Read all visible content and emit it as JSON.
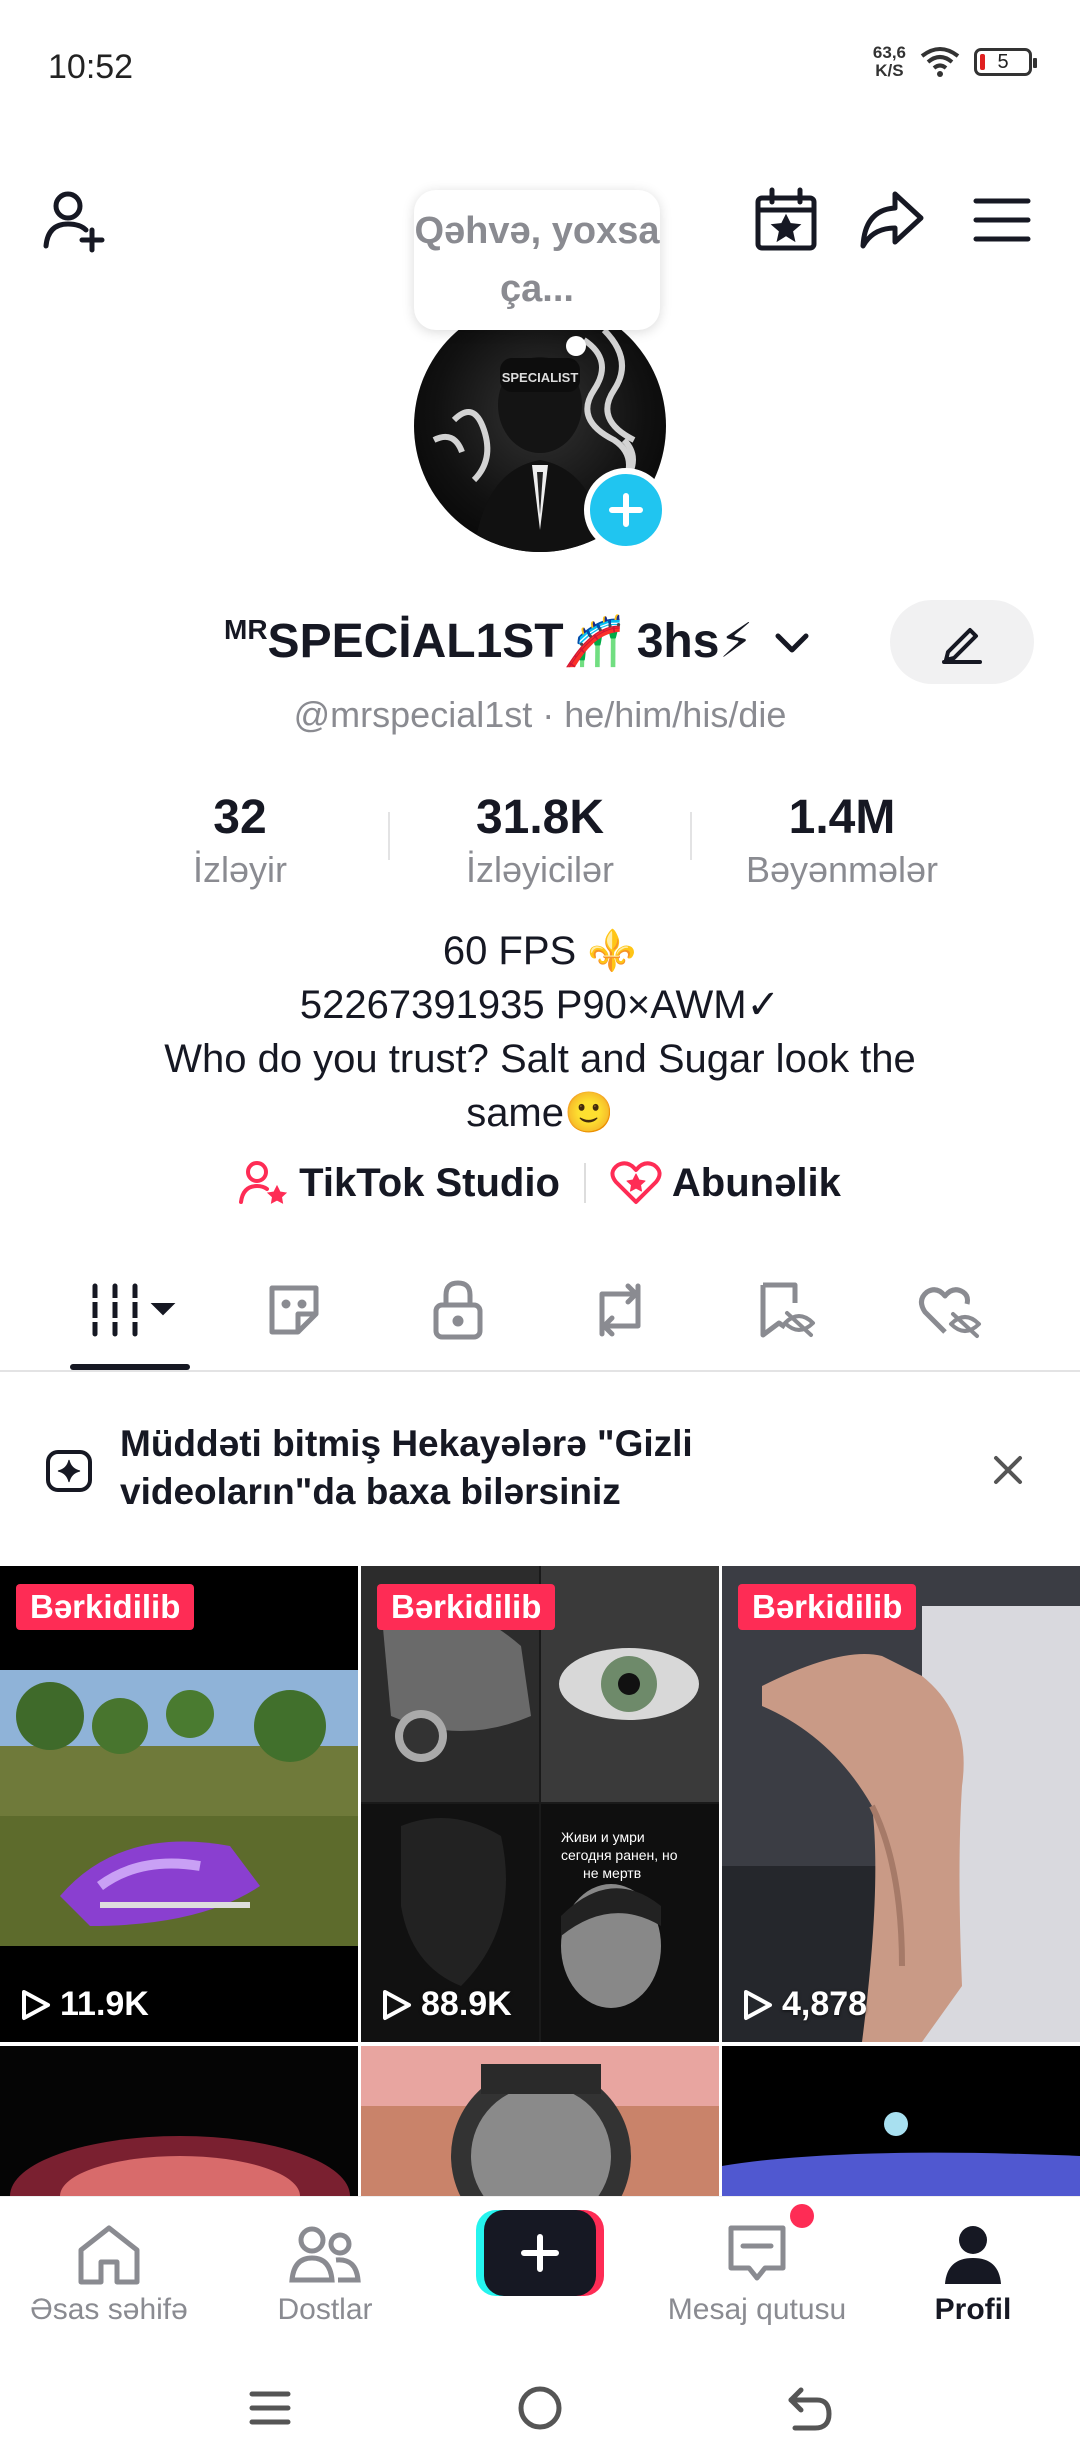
{
  "status_bar": {
    "time": "10:52",
    "net_speed_value": "63,6",
    "net_speed_unit": "K/S",
    "battery": "5",
    "battery_color": "#e02020"
  },
  "top_bar": {
    "note_bubble": "Qəhvə, yoxsa ça...",
    "icons": [
      "add-friend-icon",
      "calendar-star-icon",
      "share-icon",
      "menu-icon"
    ]
  },
  "profile": {
    "username_prefix": "MR",
    "username": "SPECİAL1ST🎢 3hs⚡",
    "handle": "@mrspecial1st · he/him/his/die",
    "stats": [
      {
        "value": "32",
        "label": "İzləyir"
      },
      {
        "value": "31.8K",
        "label": "İzləyicilər"
      },
      {
        "value": "1.4M",
        "label": "Bəyənmələr"
      }
    ],
    "bio": [
      "60 FPS ⚜️",
      "52267391935 P90×AWM✓",
      "Who do you trust? Salt and Sugar look the",
      "same🙂"
    ],
    "links": {
      "studio": "TikTok Studio",
      "subscription": "Abunəlik"
    }
  },
  "tabs": [
    "videos-grid-tab",
    "stickers-tab",
    "private-tab",
    "reposts-tab",
    "favorites-tab",
    "liked-tab"
  ],
  "notice": {
    "text": "Müddəti bitmiş Hekayələrə \"Gizli videoların\"da baxa bilərsiniz"
  },
  "videos": [
    {
      "badge": "Bərkidilib",
      "views": "11.9K"
    },
    {
      "badge": "Bərkidilib",
      "views": "88.9K",
      "overlay_text": "Живи и умри сегодня ранен, но не мертв"
    },
    {
      "badge": "Bərkidilib",
      "views": "4,878"
    }
  ],
  "bottom_nav": {
    "home": "Əsas səhifə",
    "friends": "Dostlar",
    "inbox": "Mesaj qutusu",
    "profile": "Profil"
  },
  "colors": {
    "accent": "#fe2c55",
    "cyan": "#25f4ee",
    "avatar_plus": "#20c5f0"
  }
}
